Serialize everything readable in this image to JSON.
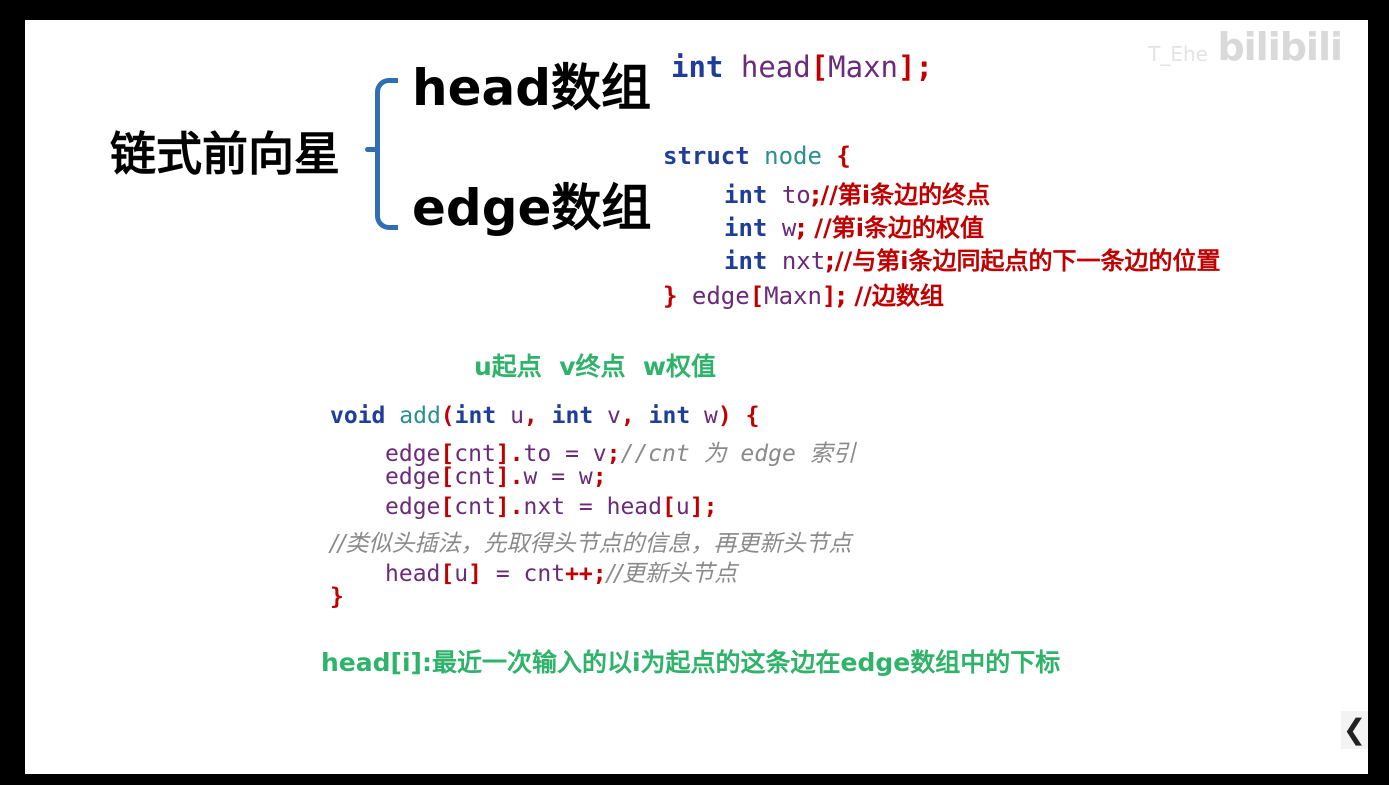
{
  "watermark": {
    "logo": "bilibili",
    "text": "T_Ehe"
  },
  "diagram": {
    "root_label": "链式前向星",
    "branch_head": "head数组",
    "branch_edge": "edge数组"
  },
  "head_decl": {
    "kw": "int",
    "name": "head",
    "lb": "[",
    "size": "Maxn",
    "rb": "]",
    "semi": ";"
  },
  "struct_code": {
    "l1_kw": "struct",
    "l1_name": "node",
    "l1_brace": "{",
    "l2_kw": "int",
    "l2_field": "to",
    "l2_comment": ";//第i条边的终点",
    "l3_kw": "int",
    "l3_field": "w",
    "l3_comment": "; //第i条边的权值",
    "l4_kw": "int",
    "l4_field": "nxt",
    "l4_comment": ";//与第i条边同起点的下一条边的位置",
    "l5_brace": "}",
    "l5_name": "edge",
    "l5_lb": "[",
    "l5_size": "Maxn",
    "l5_rb": "]",
    "l5_comment": "; //边数组"
  },
  "params_note": "u起点  v终点  w权值",
  "add_code": {
    "l1_void": "void",
    "l1_name": "add",
    "l1_lp": "(",
    "l1_int1": "int",
    "l1_u": "u",
    "l1_c1": ",",
    "l1_int2": "int",
    "l1_v": "v",
    "l1_c2": ",",
    "l1_int3": "int",
    "l1_w": "w",
    "l1_rp": ")",
    "l1_lb": "{",
    "l2_edge": "edge",
    "l2_lb": "[",
    "l2_cnt": "cnt",
    "l2_rb": "]",
    "l2_dot": ".",
    "l2_field": "to",
    "l2_eq": " = ",
    "l2_val": "v",
    "l2_semi": ";",
    "l2_comment": "//cnt 为 edge 索引",
    "l3_edge": "edge",
    "l3_lb": "[",
    "l3_cnt": "cnt",
    "l3_rb": "]",
    "l3_dot": ".",
    "l3_field": "w",
    "l3_eq": " = ",
    "l3_val": "w",
    "l3_semi": ";",
    "l4_edge": "edge",
    "l4_lb": "[",
    "l4_cnt": "cnt",
    "l4_rb": "]",
    "l4_dot": ".",
    "l4_field": "nxt",
    "l4_eq": " = ",
    "l4_head": "head",
    "l4_lb2": "[",
    "l4_u": "u",
    "l4_rb2": "]",
    "l4_semi": ";",
    "l5_comment": "//类似头插法，先取得头节点的信息，再更新头节点",
    "l6_head": "head",
    "l6_lb": "[",
    "l6_u": "u",
    "l6_rb": "]",
    "l6_eq": " = ",
    "l6_cnt": "cnt",
    "l6_pp": "++",
    "l6_semi": ";",
    "l6_comment": "//更新头节点",
    "l7_brace": "}"
  },
  "footer_note": "head[i]:最近一次输入的以i为起点的这条边在edge数组中的下标",
  "nav": {
    "prev_glyph": "❮"
  }
}
